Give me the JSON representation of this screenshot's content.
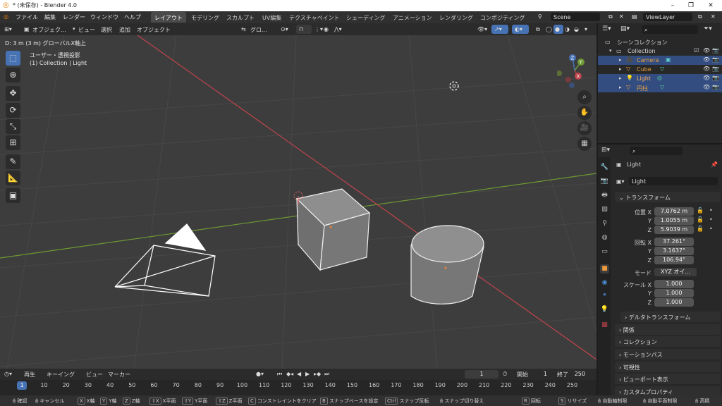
{
  "window": {
    "title": "* (未保存) - Blender 4.0"
  },
  "menu": [
    "ファイル",
    "編集",
    "レンダー",
    "ウィンドウ",
    "ヘルプ"
  ],
  "workspaces": [
    {
      "label": "レイアウト",
      "active": true
    },
    {
      "label": "モデリング"
    },
    {
      "label": "スカルプト"
    },
    {
      "label": "UV編集"
    },
    {
      "label": "テクスチャペイント"
    },
    {
      "label": "シェーディング"
    },
    {
      "label": "アニメーション"
    },
    {
      "label": "レンダリング"
    },
    {
      "label": "コンポジティング"
    }
  ],
  "scene": {
    "name": "Scene"
  },
  "viewlayer": {
    "name": "ViewLayer"
  },
  "viewport_header": {
    "mode": "オブジェク...",
    "view": "ビュー",
    "select": "選択",
    "add": "追加",
    "object": "オブジェクト",
    "transform_orientation": "グロ..."
  },
  "viewport": {
    "status": "D: 3 m (3 m) グローバルX軸上",
    "view_name": "ユーザー・透視投影",
    "collection_info": "(1) Collection | Light",
    "gizmo": {
      "x": "X",
      "y": "Y",
      "z": "Z"
    }
  },
  "outliner": {
    "scene_collection": "シーンコレクション",
    "collection": "Collection",
    "items": [
      {
        "label": "Camera",
        "icon": "camera-icon",
        "selected": true
      },
      {
        "label": "Cube",
        "icon": "mesh-icon",
        "selected": false
      },
      {
        "label": "Light",
        "icon": "light-icon",
        "selected": true
      },
      {
        "label": "円柱",
        "icon": "mesh-icon",
        "selected": true
      }
    ]
  },
  "properties": {
    "object_name": "Light",
    "data_name": "Light",
    "transform_panel": "トランスフォーム",
    "location_label": "位置 X",
    "rotation_label": "回転 X",
    "scale_label": "スケール X",
    "mode_label": "モード",
    "axis_y": "Y",
    "axis_z": "Z",
    "location": [
      "7.0762 m",
      "1.0055 m",
      "5.9039 m"
    ],
    "rotation": [
      "37.261°",
      "3.1637°",
      "106.94°"
    ],
    "rotation_mode": "XYZ オイ...",
    "scale": [
      "1.000",
      "1.000",
      "1.000"
    ],
    "delta_transform": "デルタトランスフォーム",
    "panels": [
      "関係",
      "コレクション",
      "モーションパス",
      "可視性",
      "ビューポート表示",
      "カスタムプロパティ"
    ]
  },
  "timeline": {
    "playback": "再生",
    "keying": "キーイング",
    "view": "ビュー",
    "marker": "マーカー",
    "current_frame": "1",
    "start_label": "開始",
    "start": "1",
    "end_label": "終了",
    "end": "250",
    "ticks": [
      "1",
      "10",
      "20",
      "30",
      "40",
      "50",
      "60",
      "70",
      "80",
      "90",
      "100",
      "110",
      "120",
      "130",
      "140",
      "150",
      "160",
      "170",
      "180",
      "190",
      "200",
      "210",
      "220",
      "230",
      "240",
      "250"
    ]
  },
  "statusbar": {
    "items": [
      {
        "key": "",
        "label": "確認"
      },
      {
        "key": "",
        "label": "キャンセル"
      },
      {
        "key": "X",
        "label": "X軸"
      },
      {
        "key": "Y",
        "label": "Y軸"
      },
      {
        "key": "Z",
        "label": "Z軸"
      },
      {
        "key": "⇧X",
        "label": "X平面"
      },
      {
        "key": "⇧Y",
        "label": "Y平面"
      },
      {
        "key": "⇧Z",
        "label": "Z平面"
      },
      {
        "key": "C",
        "label": "コンストレイントをクリア"
      },
      {
        "key": "B",
        "label": "スナップベースを設定"
      },
      {
        "key": "Ctrl",
        "label": "スナップ反転"
      },
      {
        "key": "",
        "label": "スナップ切り替え"
      },
      {
        "key": "R",
        "label": "回転"
      },
      {
        "key": "S",
        "label": "リサイズ"
      },
      {
        "key": "",
        "label": "自動軸制限"
      },
      {
        "key": "",
        "label": "自動平面制限"
      },
      {
        "key": "",
        "label": "高精"
      }
    ]
  },
  "colors": {
    "accent": "#4772b3",
    "x_axis": "#c0444c",
    "y_axis": "#6e9a33",
    "selection": "#334d80"
  }
}
